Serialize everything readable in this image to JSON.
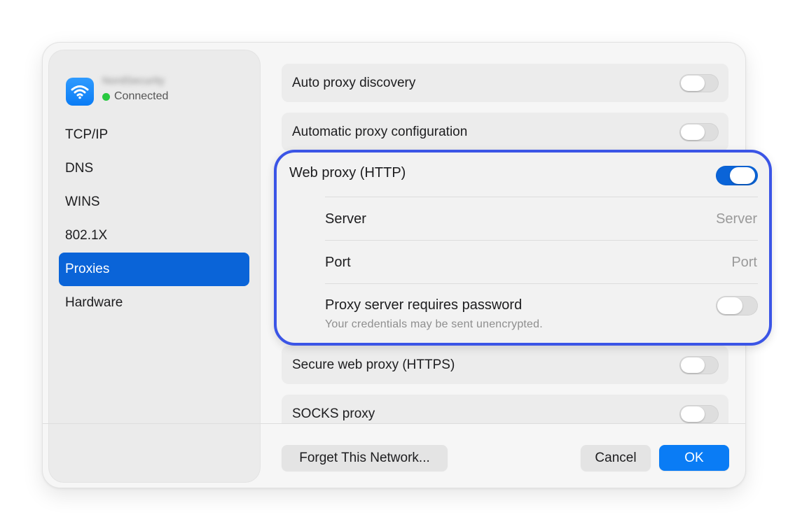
{
  "network": {
    "name": "NordSecurity",
    "status": "Connected",
    "icon": "wifi-icon",
    "status_color": "#28c940"
  },
  "sidebar": {
    "items": [
      {
        "label": "TCP/IP",
        "active": false
      },
      {
        "label": "DNS",
        "active": false
      },
      {
        "label": "WINS",
        "active": false
      },
      {
        "label": "802.1X",
        "active": false
      },
      {
        "label": "Proxies",
        "active": true
      },
      {
        "label": "Hardware",
        "active": false
      }
    ]
  },
  "proxies": {
    "auto_discovery": {
      "label": "Auto proxy discovery",
      "enabled": false
    },
    "auto_config": {
      "label": "Automatic proxy configuration",
      "enabled": false
    },
    "web_proxy": {
      "label": "Web proxy (HTTP)",
      "enabled": true,
      "server_label": "Server",
      "server_placeholder": "Server",
      "port_label": "Port",
      "port_placeholder": "Port",
      "password_label": "Proxy server requires password",
      "password_note": "Your credentials may be sent unencrypted.",
      "password_required": false
    },
    "secure_web_proxy": {
      "label": "Secure web proxy (HTTPS)",
      "enabled": false
    },
    "socks_proxy": {
      "label": "SOCKS proxy",
      "enabled": false
    }
  },
  "footer": {
    "forget_label": "Forget This Network...",
    "cancel_label": "Cancel",
    "ok_label": "OK"
  },
  "colors": {
    "accent": "#0a64d8",
    "highlight_border": "#3b55e6",
    "primary_button": "#0a7cf5"
  }
}
